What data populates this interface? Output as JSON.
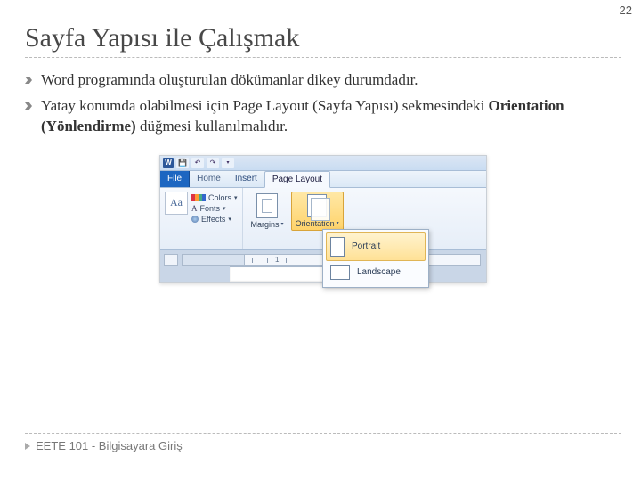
{
  "page_number": "22",
  "title": "Sayfa Yapısı ile Çalışmak",
  "bullets": [
    {
      "text": "Word programında oluşturulan dökümanlar dikey durumdadır."
    },
    {
      "html_parts": {
        "a": "Yatay konumda olabilmesi için Page Layout (Sayfa Yapısı) sekmesindeki ",
        "b": "Orientation (Yönlendirme)",
        "c": " düğmesi kullanılmalıdır."
      }
    }
  ],
  "word_ui": {
    "app_letter": "W",
    "tabs": {
      "file": "File",
      "home": "Home",
      "insert": "Insert",
      "page_layout": "Page Layout"
    },
    "themes_group": {
      "aa": "Aa",
      "colors_label": "Colors",
      "fonts_label": "Fonts",
      "effects_label": "Effects"
    },
    "page_setup": {
      "margins": "Margins",
      "orientation": "Orientation"
    },
    "orientation_menu": {
      "portrait": "Portrait",
      "landscape": "Landscape"
    },
    "ruler_numbers": [
      "1"
    ]
  },
  "footer": "EETE 101 - Bilgisayara Giriş"
}
